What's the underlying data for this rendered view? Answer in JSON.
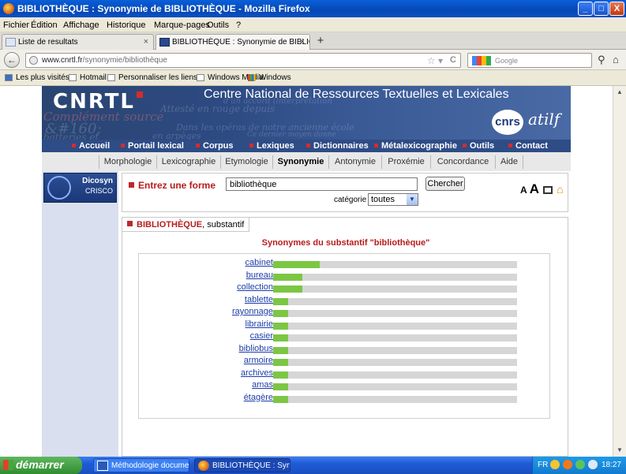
{
  "window": {
    "title": "BIBLIOTHÈQUE : Synonymie de BIBLIOTHÈQUE - Mozilla Firefox",
    "minimize_label": "_",
    "maximize_label": "□",
    "close_label": "X"
  },
  "menubar": {
    "items": [
      "Fichier",
      "Édition",
      "Affichage",
      "Historique",
      "Marque-pages",
      "Outils",
      "?"
    ]
  },
  "tabs": [
    {
      "label": "Liste de resultats",
      "active": false,
      "close": "×"
    },
    {
      "label": "BIBLIOTHÈQUE : Synonymie de BIBLIOT...",
      "active": true,
      "close": "×"
    }
  ],
  "newtab_label": "+",
  "navbar": {
    "back_label": "←",
    "url_domain": "www.cnrtl.fr",
    "url_path": "/synonymie/bibliothèque",
    "search_placeholder": "Google"
  },
  "bookmarks": [
    "Les plus visités",
    "Hotmail",
    "Personnaliser les liens",
    "Windows Media",
    "Windows"
  ],
  "site": {
    "logo": "CNRTL",
    "title": "Centre National de Ressources Textuelles et Lexicales",
    "partner1": "cnrs",
    "partner2": "atilf",
    "watermark_lines": [
      "d'un accord (interprétation",
      "Attesté en rouge depuis",
      "Complément source",
      "&#160;",
      "Dans les opéras de notre ancienne école",
      "en arpèges",
      "Ce dernier moyen donne",
      "batteries et"
    ],
    "nav": [
      "Accueil",
      "Portail lexical",
      "Corpus",
      "Lexiques",
      "Dictionnaires",
      "Métalexicographie",
      "Outils",
      "Contact"
    ],
    "nav_active": "Portail lexical",
    "subnav": [
      "Morphologie",
      "Lexicographie",
      "Etymologie",
      "Synonymie",
      "Antonymie",
      "Proxémie",
      "Concordance",
      "Aide"
    ],
    "subnav_active": "Synonymie",
    "sidebar": {
      "name": "Dicosyn",
      "sub": "CRISCO"
    },
    "form": {
      "label": "Entrez une forme",
      "value": "bibliothèque",
      "button": "Chercher",
      "category_label": "catégorie :",
      "category_value": "toutes"
    },
    "tools": {
      "small_a": "A",
      "large_a": "A"
    },
    "entry": {
      "word": "BIBLIOTHÈQUE",
      "pos": ", substantif",
      "heading": "Synonymes du substantif \"bibliothèque\""
    },
    "synonyms": [
      {
        "word": "cabinet",
        "score": 0.19
      },
      {
        "word": "bureau",
        "score": 0.12
      },
      {
        "word": "collection",
        "score": 0.12
      },
      {
        "word": "tablette",
        "score": 0.06
      },
      {
        "word": "rayonnage",
        "score": 0.06
      },
      {
        "word": "librairie",
        "score": 0.06
      },
      {
        "word": "casier",
        "score": 0.06
      },
      {
        "word": "bibliobus",
        "score": 0.06
      },
      {
        "word": "armoire",
        "score": 0.06
      },
      {
        "word": "archives",
        "score": 0.06
      },
      {
        "word": "amas",
        "score": 0.06
      },
      {
        "word": "étagère",
        "score": 0.06
      }
    ],
    "bar_color": "#7cc644"
  },
  "taskbar": {
    "start": "démarrer",
    "buttons": [
      "Méthodologie docume...",
      "BIBLIOTHÈQUE : Syn..."
    ],
    "lang": "FR",
    "clock": "18:27"
  }
}
